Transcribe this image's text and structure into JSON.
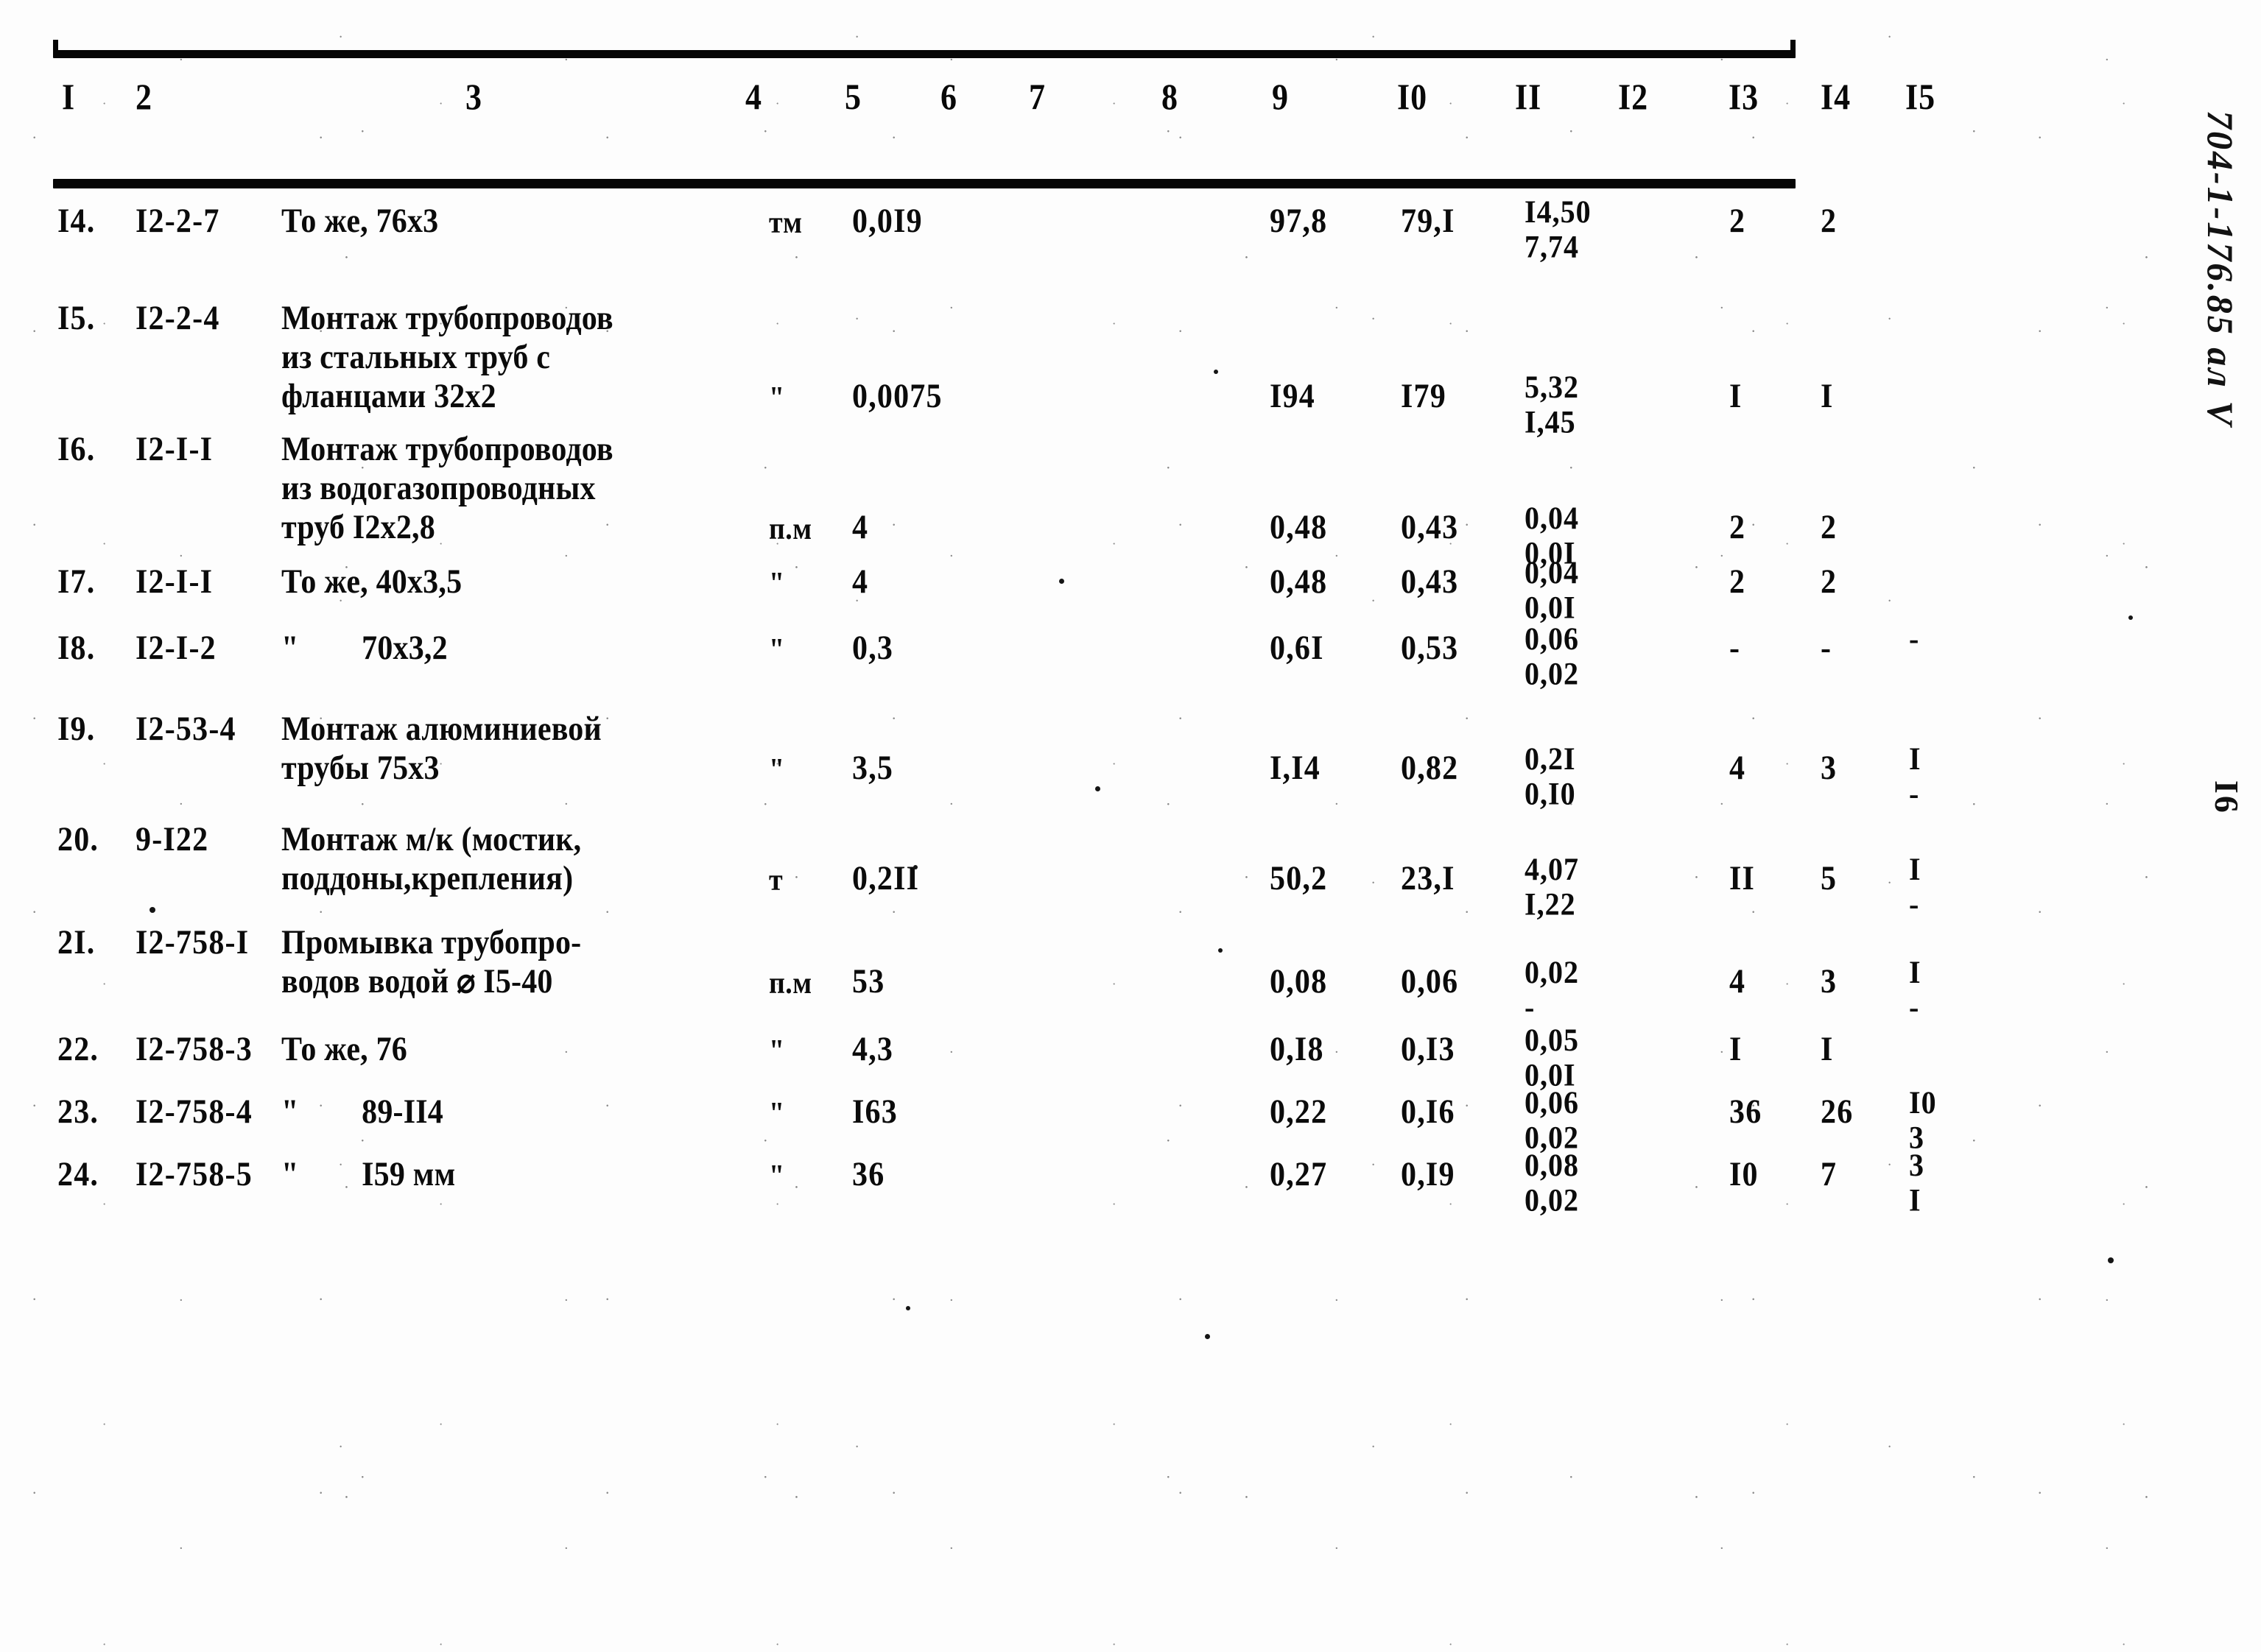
{
  "document": {
    "margin_code": "704-1-176.85  ал V",
    "page_number": "I6"
  },
  "table": {
    "column_headers": [
      "I",
      "2",
      "3",
      "4",
      "5",
      "6",
      "7",
      "8",
      "9",
      "I0",
      "II",
      "I2",
      "I3",
      "I4",
      "I5"
    ],
    "rows": [
      {
        "no": "I4.",
        "code": "I2-2-7",
        "description": [
          "То же, 76х3"
        ],
        "unit": "тм",
        "qty": "0,0I9",
        "c6": "",
        "c7": "",
        "c8": "",
        "c9": "97,8",
        "c10": "79,I",
        "c11_top": "I4,50",
        "c11_bot": "7,74",
        "c12": "",
        "c13": "2",
        "c14": "2",
        "c15_top": "",
        "c15_bot": ""
      },
      {
        "no": "I5.",
        "code": "I2-2-4",
        "description": [
          "Монтаж трубопроводов",
          "из стальных труб с",
          "фланцами 32х2"
        ],
        "unit": "\"",
        "qty": "0,0075",
        "c6": "",
        "c7": "",
        "c8": "",
        "c9": "I94",
        "c10": "I79",
        "c11_top": "5,32",
        "c11_bot": "I,45",
        "c12": "",
        "c13": "I",
        "c14": "I",
        "c15_top": "",
        "c15_bot": ""
      },
      {
        "no": "I6.",
        "code": "I2-I-I",
        "description": [
          "Монтаж трубопроводов",
          "из водогазопроводных",
          "труб I2х2,8"
        ],
        "unit": "п.м",
        "qty": "4",
        "c6": "",
        "c7": "",
        "c8": "",
        "c9": "0,48",
        "c10": "0,43",
        "c11_top": "0,04",
        "c11_bot": "0,0I",
        "c12": "",
        "c13": "2",
        "c14": "2",
        "c15_top": "",
        "c15_bot": ""
      },
      {
        "no": "I7.",
        "code": "I2-I-I",
        "description": [
          "То же, 40х3,5"
        ],
        "unit": "\"",
        "qty": "4",
        "c6": "",
        "c7": "",
        "c8": "",
        "c9": "0,48",
        "c10": "0,43",
        "c11_top": "0,04",
        "c11_bot": "0,0I",
        "c12": "",
        "c13": "2",
        "c14": "2",
        "c15_top": "",
        "c15_bot": ""
      },
      {
        "no": "I8.",
        "code": "I2-I-2",
        "description": [
          "\"        70х3,2"
        ],
        "unit": "\"",
        "qty": "0,3",
        "c6": "",
        "c7": "",
        "c8": "",
        "c9": "0,6I",
        "c10": "0,53",
        "c11_top": "0,06",
        "c11_bot": "0,02",
        "c12": "",
        "c13": "-",
        "c14": "-",
        "c15_top": "-",
        "c15_bot": ""
      },
      {
        "no": "I9.",
        "code": "I2-53-4",
        "description": [
          "Монтаж алюминиевой",
          "трубы 75х3"
        ],
        "unit": "\"",
        "qty": "3,5",
        "c6": "",
        "c7": "",
        "c8": "",
        "c9": "I,I4",
        "c10": "0,82",
        "c11_top": "0,2I",
        "c11_bot": "0,I0",
        "c12": "",
        "c13": "4",
        "c14": "3",
        "c15_top": "I",
        "c15_bot": "-"
      },
      {
        "no": "20.",
        "code": "9-I22",
        "description": [
          "Монтаж м/к (мостик,",
          "поддоны,крепления)"
        ],
        "unit": "т",
        "qty": "0,2II",
        "c6": "",
        "c7": "",
        "c8": "",
        "c9": "50,2",
        "c10": "23,I",
        "c11_top": "4,07",
        "c11_bot": "I,22",
        "c12": "",
        "c13": "II",
        "c14": "5",
        "c15_top": "I",
        "c15_bot": "-"
      },
      {
        "no": "2I.",
        "code": "I2-758-I",
        "description": [
          "Промывка трубопро-",
          "водов водой ⌀ I5-40"
        ],
        "unit": "п.м",
        "qty": "53",
        "c6": "",
        "c7": "",
        "c8": "",
        "c9": "0,08",
        "c10": "0,06",
        "c11_top": "0,02",
        "c11_bot": "-",
        "c12": "",
        "c13": "4",
        "c14": "3",
        "c15_top": "I",
        "c15_bot": "-"
      },
      {
        "no": "22.",
        "code": "I2-758-3",
        "description": [
          "То же, 76"
        ],
        "unit": "\"",
        "qty": "4,3",
        "c6": "",
        "c7": "",
        "c8": "",
        "c9": "0,I8",
        "c10": "0,I3",
        "c11_top": "0,05",
        "c11_bot": "0,0I",
        "c12": "",
        "c13": "I",
        "c14": "I",
        "c15_top": "",
        "c15_bot": ""
      },
      {
        "no": "23.",
        "code": "I2-758-4",
        "description": [
          "\"        89-II4"
        ],
        "unit": "\"",
        "qty": "I63",
        "c6": "",
        "c7": "",
        "c8": "",
        "c9": "0,22",
        "c10": "0,I6",
        "c11_top": "0,06",
        "c11_bot": "0,02",
        "c12": "",
        "c13": "36",
        "c14": "26",
        "c15_top": "I0",
        "c15_bot": "3"
      },
      {
        "no": "24.",
        "code": "I2-758-5",
        "description": [
          "\"        I59 мм"
        ],
        "unit": "\"",
        "qty": "36",
        "c6": "",
        "c7": "",
        "c8": "",
        "c9": "0,27",
        "c10": "0,I9",
        "c11_top": "0,08",
        "c11_bot": "0,02",
        "c12": "",
        "c13": "I0",
        "c14": "7",
        "c15_top": "3",
        "c15_bot": "I"
      }
    ]
  },
  "colors": {
    "ink": "#0b0b0b",
    "paper": "#fdfdfd"
  }
}
